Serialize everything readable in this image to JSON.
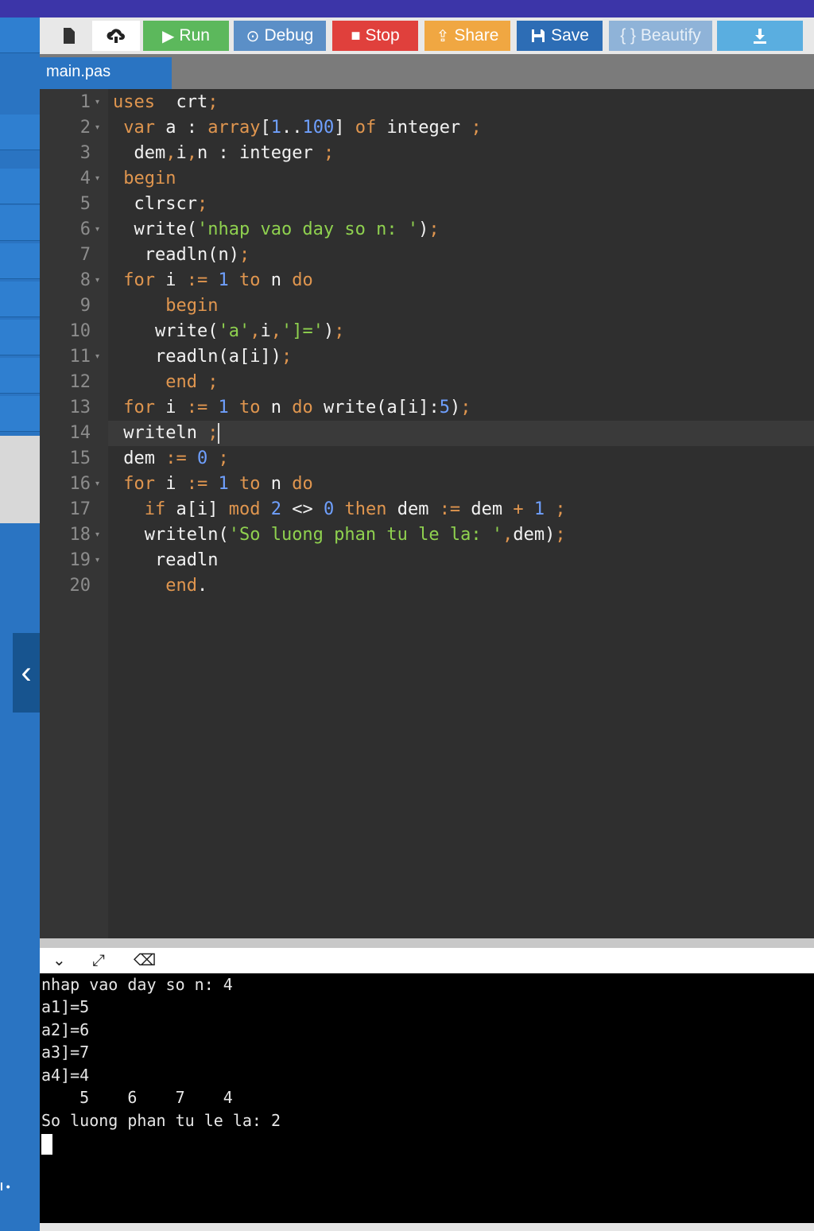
{
  "toolbar": {
    "run": "Run",
    "debug": "Debug",
    "stop": "Stop",
    "share": "Share",
    "save": "Save",
    "beautify": "{ } Beautify"
  },
  "colors": {
    "run": "#5cb85c",
    "debug": "#5b8fc7",
    "stop": "#e0403c",
    "share": "#f0a742",
    "save": "#2d6db5",
    "beautify": "#8fb3d8",
    "download": "#5aaee0"
  },
  "icons": {
    "new_file": "file-icon",
    "open": "cloud-upload-icon",
    "run": "play-icon",
    "debug": "debug-icon",
    "stop": "stop-icon",
    "share": "share-icon",
    "save": "floppy-icon",
    "download": "download-icon"
  },
  "tab": {
    "filename": "main.pas"
  },
  "editor": {
    "active_line": 14,
    "lines": [
      {
        "n": "1",
        "fold": true,
        "tokens": [
          [
            "kw",
            "uses"
          ],
          [
            "",
            "  crt"
          ],
          [
            "pun",
            ";"
          ]
        ],
        "indent": ""
      },
      {
        "n": "2",
        "fold": true,
        "tokens": [
          [
            "kw",
            "var"
          ],
          [
            "",
            " a : "
          ],
          [
            "kw",
            "array"
          ],
          [
            "",
            "["
          ],
          [
            "num",
            "1"
          ],
          [
            "",
            ".."
          ],
          [
            "num",
            "100"
          ],
          [
            "",
            "] "
          ],
          [
            "kw",
            "of"
          ],
          [
            "",
            " integer "
          ],
          [
            "pun",
            ";"
          ]
        ],
        "indent": " "
      },
      {
        "n": "3",
        "fold": false,
        "tokens": [
          [
            "",
            "dem"
          ],
          [
            "pun",
            ","
          ],
          [
            "",
            "i"
          ],
          [
            "pun",
            ","
          ],
          [
            "",
            "n : integer "
          ],
          [
            "pun",
            ";"
          ]
        ],
        "indent": "  "
      },
      {
        "n": "4",
        "fold": true,
        "tokens": [
          [
            "kw",
            "begin"
          ]
        ],
        "indent": " "
      },
      {
        "n": "5",
        "fold": false,
        "tokens": [
          [
            "",
            "clrscr"
          ],
          [
            "pun",
            ";"
          ]
        ],
        "indent": "  "
      },
      {
        "n": "6",
        "fold": true,
        "tokens": [
          [
            "",
            "write("
          ],
          [
            "str",
            "'nhap vao day so n: '"
          ],
          [
            "",
            ")"
          ],
          [
            "pun",
            ";"
          ]
        ],
        "indent": "  "
      },
      {
        "n": "7",
        "fold": false,
        "tokens": [
          [
            "",
            "readln(n)"
          ],
          [
            "pun",
            ";"
          ]
        ],
        "indent": "   "
      },
      {
        "n": "8",
        "fold": true,
        "tokens": [
          [
            "kw",
            "for"
          ],
          [
            "",
            " i "
          ],
          [
            "pun",
            ":="
          ],
          [
            " ",
            ""
          ],
          [
            "num",
            " 1"
          ],
          [
            "kw",
            " to"
          ],
          [
            "",
            " n "
          ],
          [
            "kw",
            "do"
          ]
        ],
        "indent": " "
      },
      {
        "n": "9",
        "fold": false,
        "tokens": [
          [
            "kw",
            "begin"
          ]
        ],
        "indent": "     "
      },
      {
        "n": "10",
        "fold": false,
        "tokens": [
          [
            "",
            "write("
          ],
          [
            "str",
            "'a'"
          ],
          [
            "pun",
            ","
          ],
          [
            "",
            "i"
          ],
          [
            "pun",
            ","
          ],
          [
            "str",
            "']='"
          ],
          [
            "",
            ")"
          ],
          [
            "pun",
            ";"
          ]
        ],
        "indent": "    "
      },
      {
        "n": "11",
        "fold": true,
        "tokens": [
          [
            "",
            "readln(a[i])"
          ],
          [
            "pun",
            ";"
          ]
        ],
        "indent": "    "
      },
      {
        "n": "12",
        "fold": false,
        "tokens": [
          [
            "kw",
            "end"
          ],
          [
            "",
            " "
          ],
          [
            "pun",
            ";"
          ]
        ],
        "indent": "     "
      },
      {
        "n": "13",
        "fold": false,
        "tokens": [
          [
            "kw",
            "for"
          ],
          [
            "",
            " i "
          ],
          [
            "pun",
            ":="
          ],
          [
            "num",
            " 1"
          ],
          [
            "kw",
            " to"
          ],
          [
            "",
            " n "
          ],
          [
            "kw",
            "do"
          ],
          [
            "",
            " write(a[i]:"
          ],
          [
            "num",
            "5"
          ],
          [
            "",
            ")"
          ],
          [
            "pun",
            ";"
          ]
        ],
        "indent": " "
      },
      {
        "n": "14",
        "fold": false,
        "tokens": [
          [
            "",
            "writeln "
          ],
          [
            "pun",
            ";"
          ]
        ],
        "indent": " "
      },
      {
        "n": "15",
        "fold": false,
        "tokens": [
          [
            "",
            "dem "
          ],
          [
            "pun",
            ":="
          ],
          [
            "",
            " "
          ],
          [
            "num",
            "0"
          ],
          [
            "",
            " "
          ],
          [
            "pun",
            ";"
          ]
        ],
        "indent": " "
      },
      {
        "n": "16",
        "fold": true,
        "tokens": [
          [
            "kw",
            "for"
          ],
          [
            "",
            " i "
          ],
          [
            "pun",
            ":="
          ],
          [
            "num",
            " 1"
          ],
          [
            "kw",
            " to"
          ],
          [
            "",
            " n "
          ],
          [
            "kw",
            "do"
          ]
        ],
        "indent": " "
      },
      {
        "n": "17",
        "fold": false,
        "tokens": [
          [
            "kw",
            "if"
          ],
          [
            "",
            " a[i] "
          ],
          [
            "kw",
            "mod"
          ],
          [
            "",
            " "
          ],
          [
            "num",
            "2"
          ],
          [
            "",
            " <> "
          ],
          [
            "num",
            "0"
          ],
          [
            "",
            " "
          ],
          [
            "kw",
            "then"
          ],
          [
            "",
            " dem "
          ],
          [
            "pun",
            ":="
          ],
          [
            "",
            " dem "
          ],
          [
            "pun",
            "+"
          ],
          [
            "",
            " "
          ],
          [
            "num",
            "1"
          ],
          [
            "",
            " "
          ],
          [
            "pun",
            ";"
          ]
        ],
        "indent": "   "
      },
      {
        "n": "18",
        "fold": true,
        "tokens": [
          [
            "",
            "writeln("
          ],
          [
            "str",
            "'So luong phan tu le la: '"
          ],
          [
            "pun",
            ","
          ],
          [
            "",
            "dem)"
          ],
          [
            "pun",
            ";"
          ]
        ],
        "indent": "   "
      },
      {
        "n": "19",
        "fold": true,
        "tokens": [
          [
            "",
            "readln"
          ]
        ],
        "indent": "    "
      },
      {
        "n": "20",
        "fold": false,
        "tokens": [
          [
            "kw",
            "end"
          ],
          [
            "",
            "."
          ]
        ],
        "indent": "     "
      }
    ]
  },
  "console": {
    "lines": [
      "nhap vao day so n: 4",
      "a1]=5",
      "a2]=6",
      "a3]=7",
      "a4]=4",
      "    5    6    7    4",
      "So luong phan tu le la: 2"
    ]
  },
  "sidebar": {
    "mini_label": "l •"
  }
}
